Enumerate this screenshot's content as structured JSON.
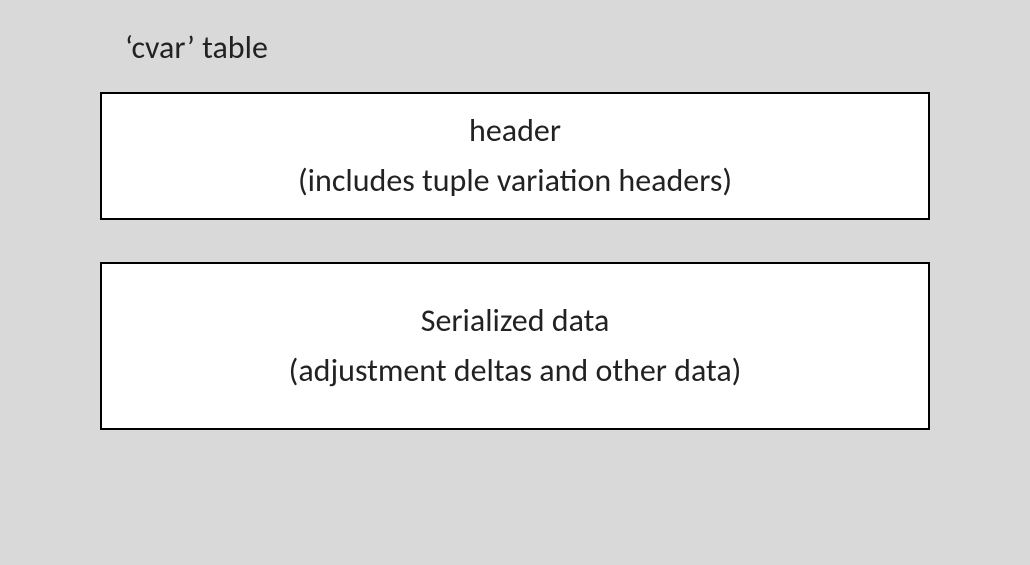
{
  "diagram": {
    "title": "‘cvar’ table",
    "boxes": [
      {
        "line1": "header",
        "line2": "(includes tuple variation headers)"
      },
      {
        "line1": "Serialized data",
        "line2": "(adjustment deltas and other data)"
      }
    ]
  }
}
